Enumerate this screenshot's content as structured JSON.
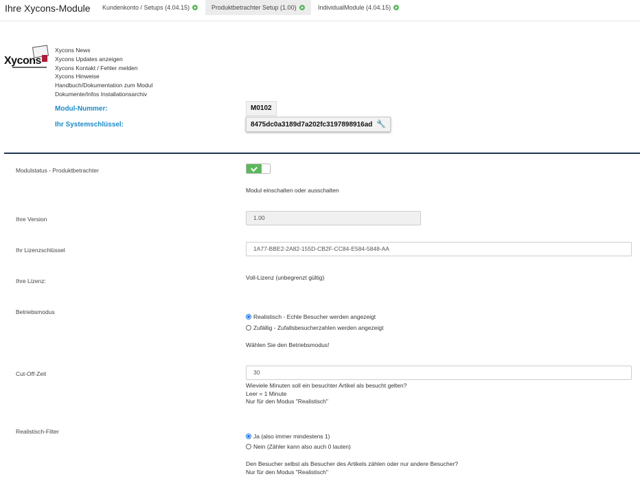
{
  "header": {
    "title": "Ihre Xycons-Module",
    "tabs": [
      {
        "label": "Kundenkonto / Setups (4.04.15)",
        "status": "active-green"
      },
      {
        "label": "Produktbetrachter Setup (1.00)",
        "status": "active-green"
      },
      {
        "label": "IndividualModule (4.04.15)",
        "status": "active-green"
      }
    ]
  },
  "logo": {
    "text": "Xycons"
  },
  "links": [
    "Xycons News",
    "Xycons Updates anzeigen",
    "Xycons Kontakt / Fehler melden",
    "Xycons Hinweise",
    "Handbuch/Dokumentation zum Modul",
    "Dokumente/Infos Installationsarchiv"
  ],
  "module_info": {
    "number_label": "Modul-Nummer:",
    "number_value": "M0102",
    "key_label": "Ihr Systemschlüssel:",
    "key_value": "8475dc0a3189d7a202fc3197898916ad"
  },
  "settings": {
    "modulstatus": {
      "label": "Modulstatus - Produktbetrachter",
      "enabled": true,
      "help": "Modul einschalten oder ausschalten"
    },
    "version": {
      "label": "Ihre Version",
      "value": "1.00"
    },
    "lizenzschluessel": {
      "label": "Ihr Lizenzschlüssel",
      "value": "1A77-BBE2-2A82-155D-CB2F-CC84-E584-5848-AA"
    },
    "lizenz": {
      "label": "Ihre Lizenz:",
      "value": "Voll-Lizenz (unbegrenzt gültig)"
    },
    "betriebsmodus": {
      "label": "Betriebsmodus",
      "options": [
        {
          "label": "Realistisch - Echte Besucher werden angezeigt",
          "checked": true
        },
        {
          "label": "Zufällig - Zufallsbesucherzahlen werden angezeigt",
          "checked": false
        }
      ],
      "help": "Wählen Sie den Betriebsmodus!"
    },
    "cutoff": {
      "label": "Cut-Off-Zeit",
      "value": "30",
      "help": [
        "Wieviele Minuten soll ein besuchter Artikel als besucht gelten?",
        "Leer = 1 Minute",
        "Nur für den Modus \"Realistisch\""
      ]
    },
    "filter": {
      "label": "Realistisch-Filter",
      "options": [
        {
          "label": "Ja (also immer mindestens 1)",
          "checked": true
        },
        {
          "label": "Nein (Zähler kann also auch 0 lauten)",
          "checked": false
        }
      ],
      "help": [
        "Den Besucher selbst als Besucher des Artikels zählen oder nur andere Besucher?",
        "Nur für den Modus \"Realistisch\""
      ]
    }
  }
}
